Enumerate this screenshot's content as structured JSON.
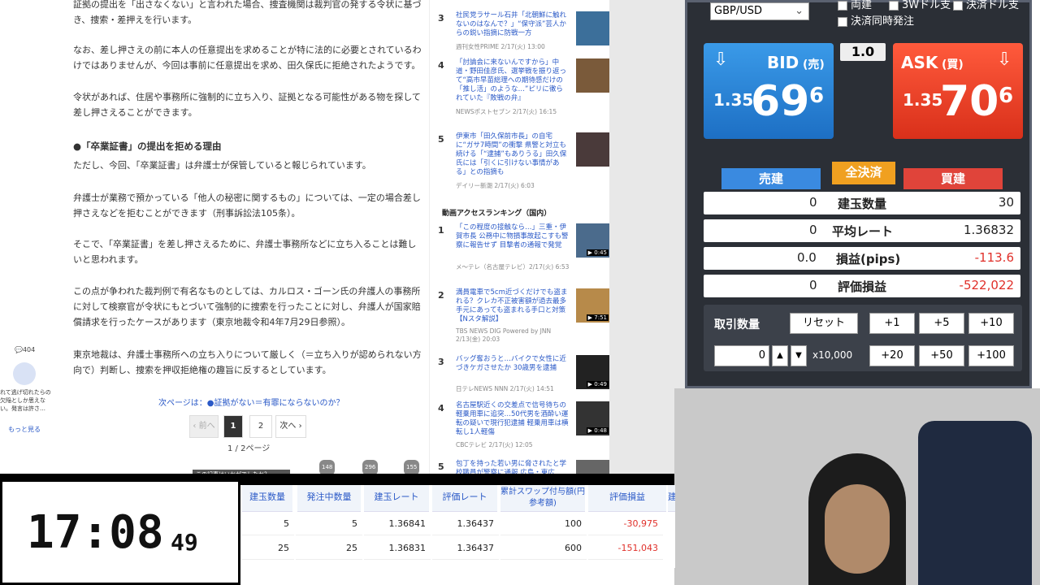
{
  "article": {
    "top_partial": "証拠の提出を「出さなくない」と言われた場合、捜査機関は裁判官の発する令状に基づき、捜索・差押えを行います。",
    "p1": "なお、差し押さえの前に本人の任意提出を求めることが特に法的に必要とされているわけではありませんが、今回は事前に任意提出を求め、田久保氏に拒絶されたようです。",
    "p2": "令状があれば、住居や事務所に強制的に立ち入り、証拠となる可能性がある物を探して差し押さえることができます。",
    "heading": "●「卒業証書」の提出を拒める理由",
    "p3": "ただし、今回、「卒業証書」は弁護士が保管していると報じられています。",
    "p4": "弁護士が業務で預かっている「他人の秘密に関するもの」については、一定の場合差し押さえなどを拒むことができます（刑事訴訟法105条）。",
    "p5": "そこで、「卒業証書」を差し押さえるために、弁護士事務所などに立ち入ることは難しいと思われます。",
    "p6": "この点が争われた裁判例で有名なものとしては、カルロス・ゴーン氏の弁護人の事務所に対して検察官が令状にもとづいて強制的に捜索を行ったことに対し、弁護人が国家賠償請求を行ったケースがあります（東京地裁令和4年7月29日参照）。",
    "p7": "東京地裁は、弁護士事務所への立ち入りについて厳しく（＝立ち入りが認められない方向で）判断し、捜索を押収拒絶権の趣旨に反するとしています。",
    "next_page": "次ページは：●証拠がない＝有罪にならないのか？",
    "pager": {
      "prev": "‹ 前へ",
      "p1": "1",
      "p2": "2",
      "next": "次へ ›",
      "total": "1 / 2ページ"
    },
    "float_counts": [
      "148",
      "296",
      "155"
    ],
    "float_label": "この記事はいかがでしたか？"
  },
  "left_rail": {
    "count": "404",
    "comment": "れて逃げ切れたらの欠陥としか思えない。発言は許さ…",
    "more": "もっと見る"
  },
  "ranking": {
    "items_top": [
      {
        "n": "3",
        "title": "社民党ラサール石井「北朝鮮に触れないのはなんで？」“保守派”芸人からの鋭い指摘に防戦一方",
        "source": "週刊女性PRIME 2/17(火) 13:00"
      },
      {
        "n": "4",
        "title": "「討論会に来ないんですから」中道・野田佳彦氏、選挙戦を振り返って“高市早苗総理への期待感だけの「推し活」のような…”ピリに徹られていた『敗戦の弁』",
        "source": "NEWSポストセブン 2/17(火) 16:15"
      },
      {
        "n": "5",
        "title": "伊東市「田久保前市長」の自宅に“ガサ7時間”の衝撃 県警と対立も続ける「“逮捕”もありうる」田久保氏には「引くに引けない事情がある」との指摘も",
        "source": "デイリー新潮 2/17(火) 6:03"
      }
    ],
    "video_heading": "動画アクセスランキング（国内）",
    "video_items": [
      {
        "n": "1",
        "title": "「この程度の接触なら…」三重・伊賀市長 公務中に物損事故起こすも警察に報告せず 目撃者の通報で発覚",
        "source": "メ～テレ（名古屋テレビ）2/17(火) 6:53",
        "dur": "▶ 0:45"
      },
      {
        "n": "2",
        "title": "満員電車で5cm近づくだけでも盗まれる？クレカ不正被害額が過去最多 手元にあっても盗まれる手口と対策【Nスタ解説】",
        "source": "TBS NEWS DIG Powered by JNN 2/13(金) 20:03",
        "dur": "▶ 7:51"
      },
      {
        "n": "3",
        "title": "バッグ奪おうと…バイクで女性に近づきケガさせたか 30歳男を逮捕",
        "source": "日テレNEWS NNN 2/17(火) 14:51",
        "dur": "▶ 0:49"
      },
      {
        "n": "4",
        "title": "名古屋駅近くの交差点で信号待ちの軽乗用車に追突…50代男を酒酔い運転の疑いで現行犯逮捕 軽乗用車は横転し1人軽傷",
        "source": "CBCテレビ 2/17(火) 12:05",
        "dur": "▶ 0:48"
      },
      {
        "n": "5",
        "title": "包丁を持った若い男に脅されたと学校職員が警察に通報 広島・東広",
        "source": "",
        "dur": ""
      }
    ]
  },
  "panel": {
    "currency": "GBP/USD",
    "checks": [
      "両建",
      "3Wドル支",
      "決済ドル支",
      "決済同時発注"
    ],
    "spread": "1.0",
    "bid": {
      "label": "BID",
      "side": "(売)",
      "prefix": "1.35",
      "main": "69",
      "sup": "6"
    },
    "ask": {
      "label": "ASK",
      "side": "(買)",
      "prefix": "1.35",
      "main": "70",
      "sup": "6"
    },
    "tabs": {
      "sell": "売建",
      "close_all": "全決済",
      "buy": "買建"
    },
    "stats": [
      {
        "left": "0",
        "label": "建玉数量",
        "right": "30",
        "right_color": "#222"
      },
      {
        "left": "0",
        "label": "平均レート",
        "right": "1.36832",
        "right_color": "#222"
      },
      {
        "left": "0.0",
        "label": "損益(pips)",
        "right": "-113.6",
        "right_color": "#e0302a"
      },
      {
        "left": "0",
        "label": "評価損益",
        "right": "-522,022",
        "right_color": "#e0302a"
      }
    ],
    "qty_label": "取引数量",
    "reset": "リセット",
    "plus_row1": [
      "+1",
      "+5",
      "+10"
    ],
    "plus_row2": [
      "+20",
      "+50",
      "+100"
    ],
    "qty_value": "0",
    "multiplier": "x10,000"
  },
  "clock": {
    "hm": "17:08",
    "sec": "49"
  },
  "positions": {
    "headers": [
      "建玉数量",
      "発注中数量",
      "建玉レート",
      "評価レート",
      "累計スワップ付与額(円参考額)",
      "評価損益",
      "建"
    ],
    "rows": [
      [
        "5",
        "5",
        "1.36841",
        "1.36437",
        "100",
        "-30,975"
      ],
      [
        "25",
        "25",
        "1.36831",
        "1.36437",
        "600",
        "-151,043"
      ]
    ]
  }
}
